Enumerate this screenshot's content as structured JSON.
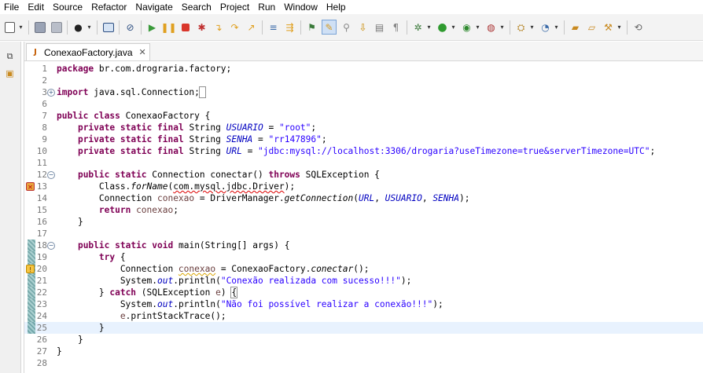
{
  "menu": [
    "File",
    "Edit",
    "Source",
    "Refactor",
    "Navigate",
    "Search",
    "Project",
    "Run",
    "Window",
    "Help"
  ],
  "toolbar": {
    "icons": [
      "new-icon",
      "save-icon",
      "save-all-icon",
      "console-icon",
      "skip-breakpoints-icon",
      "resume-icon",
      "suspend-icon",
      "terminate-icon",
      "disconnect-icon",
      "step-into-icon",
      "step-over-icon",
      "step-return-icon",
      "drop-to-frame-icon",
      "use-step-filters-icon",
      "toggle-mark-occurrences-icon",
      "highlighter-icon",
      "show-whitespace-icon",
      "debug-icon",
      "run-icon",
      "coverage-icon",
      "external-tools-icon",
      "new-java-project-icon",
      "new-package-icon",
      "new-class-icon",
      "open-type-icon",
      "search-icon"
    ]
  },
  "editor": {
    "tab_title": "ConexaoFactory.java",
    "lines": [
      {
        "n": "1",
        "text": "package br.com.drograria.factory;"
      },
      {
        "n": "2",
        "text": ""
      },
      {
        "n": "3",
        "text": "import java.sql.Connection;"
      },
      {
        "n": "6",
        "text": ""
      },
      {
        "n": "7",
        "text": "public class ConexaoFactory {"
      },
      {
        "n": "8",
        "text": "    private static final String USUARIO = \"root\";"
      },
      {
        "n": "9",
        "text": "    private static final String SENHA = \"rr147896\";"
      },
      {
        "n": "10",
        "text": "    private static final String URL = \"jdbc:mysql://localhost:3306/drogaria?useTimezone=true&serverTimezone=UTC\";"
      },
      {
        "n": "11",
        "text": ""
      },
      {
        "n": "12",
        "text": "    public static Connection conectar() throws SQLException {"
      },
      {
        "n": "13",
        "text": "        Class.forName(com.mysql.jdbc.Driver);"
      },
      {
        "n": "14",
        "text": "        Connection conexao = DriverManager.getConnection(URL, USUARIO, SENHA);"
      },
      {
        "n": "15",
        "text": "        return conexao;"
      },
      {
        "n": "16",
        "text": "    }"
      },
      {
        "n": "17",
        "text": ""
      },
      {
        "n": "18",
        "text": "    public static void main(String[] args) {"
      },
      {
        "n": "19",
        "text": "        try {"
      },
      {
        "n": "20",
        "text": "            Connection conexao = ConexaoFactory.conectar();"
      },
      {
        "n": "21",
        "text": "            System.out.println(\"Conexão realizada com sucesso!!!\");"
      },
      {
        "n": "22",
        "text": "        } catch (SQLException e) {"
      },
      {
        "n": "23",
        "text": "            System.out.println(\"Não foi possível realizar a conexão!!!\");"
      },
      {
        "n": "24",
        "text": "            e.printStackTrace();"
      },
      {
        "n": "25",
        "text": "        }"
      },
      {
        "n": "26",
        "text": "    }"
      },
      {
        "n": "27",
        "text": "}"
      },
      {
        "n": "28",
        "text": ""
      }
    ]
  },
  "colors": {
    "keyword": "#7f0055",
    "string": "#2a00ff",
    "field": "#0000c0",
    "current_line": "#e8f2fe"
  }
}
